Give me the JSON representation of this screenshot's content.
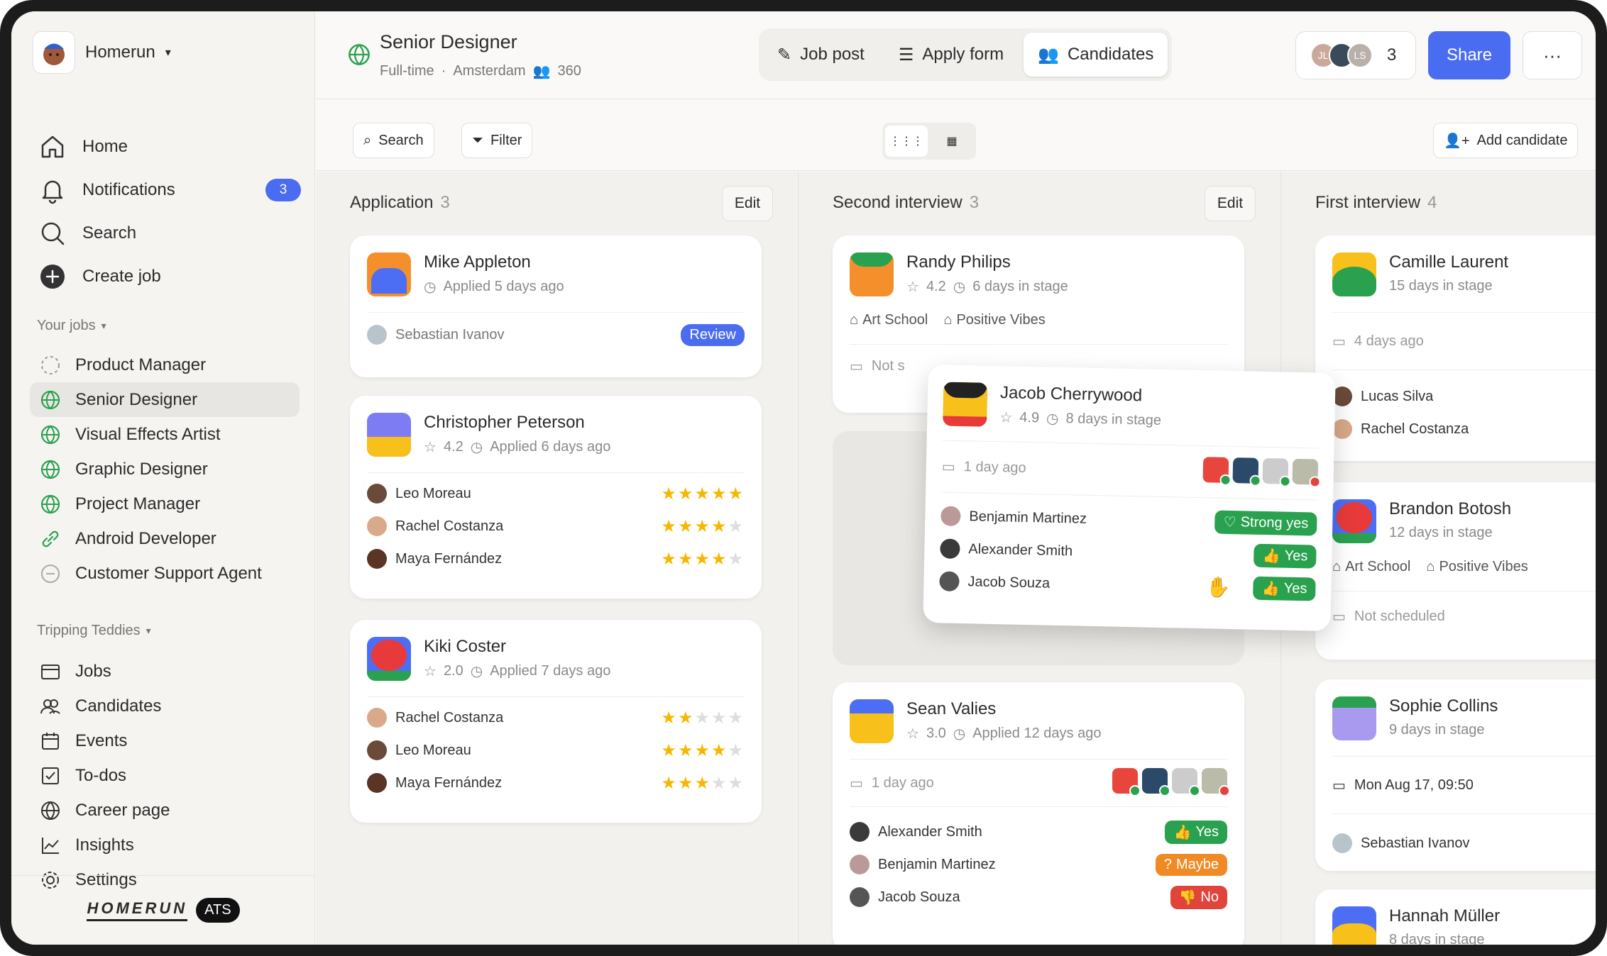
{
  "workspace": {
    "name": "Homerun"
  },
  "nav": [
    {
      "label": "Home",
      "icon": "home-icon"
    },
    {
      "label": "Notifications",
      "icon": "bell-icon",
      "badge": "3"
    },
    {
      "label": "Search",
      "icon": "search-icon"
    },
    {
      "label": "Create job",
      "icon": "plus-circle-icon"
    }
  ],
  "your_jobs_label": "Your jobs",
  "jobs": [
    "Product Manager",
    "Senior Designer",
    "Visual Effects Artist",
    "Graphic Designer",
    "Project Manager",
    "Android Developer",
    "Customer Support Agent"
  ],
  "team_label": "Tripping Teddies",
  "team_nav": [
    "Jobs",
    "Candidates",
    "Events",
    "To-dos",
    "Career page",
    "Insights",
    "Settings"
  ],
  "footer": {
    "brand": "HOMERUN",
    "ats": "ATS"
  },
  "header": {
    "title": "Senior Designer",
    "type": "Full-time",
    "location": "Amsterdam",
    "applicants": "360",
    "tabs": [
      "Job post",
      "Apply form",
      "Candidates"
    ],
    "people_count": "3",
    "avatars": [
      "JL",
      "",
      "LS"
    ],
    "share": "Share",
    "more": "···"
  },
  "toolbar": {
    "search": "Search",
    "filter": "Filter",
    "add": "Add candidate"
  },
  "columns": [
    {
      "title": "Application",
      "count": "3",
      "edit": "Edit"
    },
    {
      "title": "Second interview",
      "count": "3",
      "edit": "Edit"
    },
    {
      "title": "First interview",
      "count": "4"
    }
  ],
  "application": [
    {
      "name": "Mike Appleton",
      "meta": "Applied 5 days ago",
      "owner": "Sebastian Ivanov",
      "action": "Review"
    },
    {
      "name": "Christopher Peterson",
      "rating": "4.2",
      "meta": "Applied 6 days ago",
      "reviews": [
        {
          "name": "Leo Moreau",
          "stars": 5
        },
        {
          "name": "Rachel Costanza",
          "stars": 4
        },
        {
          "name": "Maya Fernández",
          "stars": 4
        }
      ]
    },
    {
      "name": "Kiki Coster",
      "rating": "2.0",
      "meta": "Applied 7 days ago",
      "reviews": [
        {
          "name": "Rachel Costanza",
          "stars": 2
        },
        {
          "name": "Leo Moreau",
          "stars": 4
        },
        {
          "name": "Maya Fernández",
          "stars": 3
        }
      ]
    }
  ],
  "second": [
    {
      "name": "Randy Philips",
      "rating": "4.2",
      "meta": "6 days in stage",
      "tags": [
        "Art School",
        "Positive Vibes"
      ],
      "event": "Not s"
    },
    {
      "name": "Sean Valies",
      "rating": "3.0",
      "meta": "Applied 12 days ago",
      "event": "1 day ago",
      "votes": [
        {
          "name": "Alexander Smith",
          "vote": "Yes"
        },
        {
          "name": "Benjamin Martinez",
          "vote": "Maybe"
        },
        {
          "name": "Jacob Souza",
          "vote": "No"
        }
      ]
    }
  ],
  "dragging": {
    "name": "Jacob Cherrywood",
    "rating": "4.9",
    "meta": "8 days in stage",
    "event": "1 day ago",
    "votes": [
      {
        "name": "Benjamin Martinez",
        "vote": "Strong yes"
      },
      {
        "name": "Alexander Smith",
        "vote": "Yes"
      },
      {
        "name": "Jacob Souza",
        "vote": "Yes"
      }
    ]
  },
  "first": [
    {
      "name": "Camille Laurent",
      "meta": "15 days in stage",
      "event": "4 days ago",
      "people": [
        "Lucas Silva",
        "Rachel Costanza"
      ]
    },
    {
      "name": "Brandon Botosh",
      "meta": "12 days in stage",
      "tags": [
        "Art School",
        "Positive Vibes"
      ],
      "event": "Not scheduled"
    },
    {
      "name": "Sophie Collins",
      "meta": "9 days in stage",
      "event": "Mon Aug 17, 09:50",
      "owner": "Sebastian Ivanov"
    },
    {
      "name": "Hannah Müller",
      "meta": "8 days in stage"
    }
  ],
  "colors": {
    "accent": "#4a6cf0",
    "green": "#2aa14f",
    "orange": "#f08a24",
    "red": "#e0443a"
  }
}
